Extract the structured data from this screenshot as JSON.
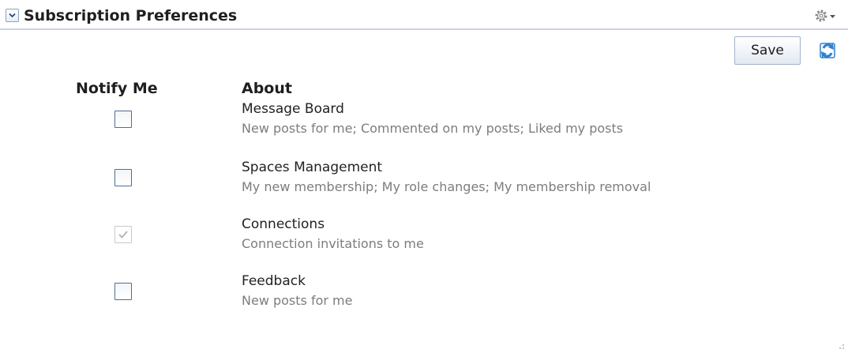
{
  "panel": {
    "title": "Subscription Preferences",
    "collapse_icon": "chevron-down-icon",
    "menu_icon": "gear-icon"
  },
  "toolbar": {
    "save_label": "Save",
    "refresh_icon": "refresh-icon"
  },
  "columns": {
    "notify_label": "Notify Me",
    "about_label": "About"
  },
  "preferences": [
    {
      "name": "Message Board",
      "description": "New posts for me; Commented on my posts; Liked my posts",
      "checked": false,
      "disabled": false
    },
    {
      "name": "Spaces Management",
      "description": "My new membership; My role changes; My membership removal",
      "checked": false,
      "disabled": false
    },
    {
      "name": "Connections",
      "description": "Connection invitations to me",
      "checked": true,
      "disabled": true
    },
    {
      "name": "Feedback",
      "description": "New posts for me",
      "checked": false,
      "disabled": false
    }
  ],
  "colors": {
    "header_rule": "#c9d3e4",
    "checkbox_border": "#4b6f96",
    "description_text": "#7d7d7d",
    "refresh_icon": "#2f7fd0"
  }
}
